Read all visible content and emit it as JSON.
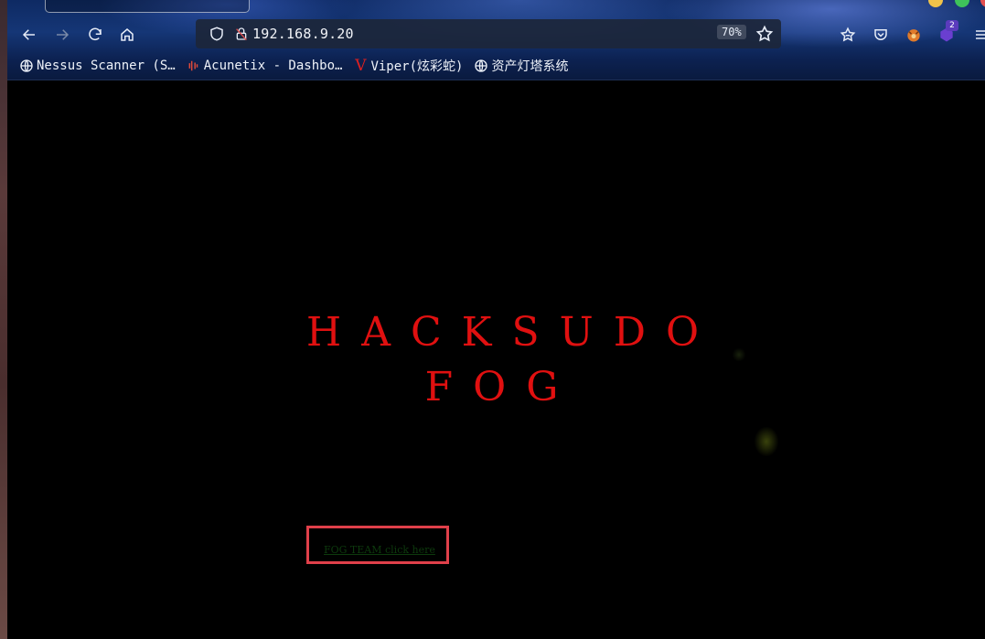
{
  "browser": {
    "url": "192.168.9.20",
    "zoom": "70%",
    "extension_badge_count": "2"
  },
  "bookmarks": [
    {
      "label": "Nessus Scanner (S…",
      "icon": "globe-icon"
    },
    {
      "label": "Acunetix - Dashbo…",
      "icon": "acunetix-icon"
    },
    {
      "label": "Viper(炫彩蛇)",
      "icon": "viper-icon"
    },
    {
      "label": "资产灯塔系统",
      "icon": "globe-icon"
    }
  ],
  "page": {
    "title_line1": "HACKSUDO",
    "title_line2": "FOG",
    "link_text": "FOG TEAM click here"
  },
  "colors": {
    "title": "#e01010",
    "highlight_box": "#e0404a",
    "link": "#0d3a0d"
  }
}
